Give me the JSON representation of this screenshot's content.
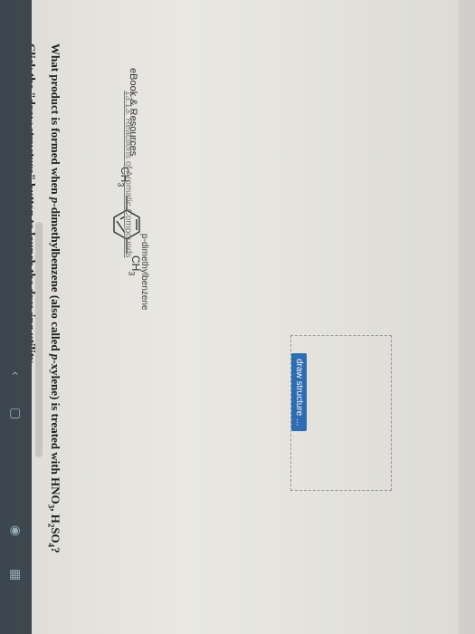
{
  "question": {
    "instruction": "Click the \"draw structure\" button to launch the drawing utility.",
    "prompt_before": "What product is formed when ",
    "prompt_italic_1": "p",
    "prompt_middle": "-dimethylbenzene (also called ",
    "prompt_italic_2": "p",
    "prompt_after": "-xylene) is treated with HNO",
    "sub_1": "3",
    "comma": ", H",
    "sub_2": "2",
    "so": "SO",
    "sub_3": "4",
    "qmark": "?"
  },
  "molecule": {
    "left_group": "CH",
    "left_sub": "3",
    "right_group": "CH",
    "right_sub": "3",
    "caption": "p-dimethylbenzene"
  },
  "draw_button": {
    "label": "draw structure ..."
  },
  "ebook": {
    "heading": "eBook & Resources",
    "link": "13.13. Reactions of Aromatic Compounds"
  },
  "colors": {
    "button": "#2f6fb7",
    "panel": "#3f4a54"
  },
  "icons": [
    "chevron-icon",
    "window-icon",
    "grid-icon",
    "camera-icon"
  ]
}
